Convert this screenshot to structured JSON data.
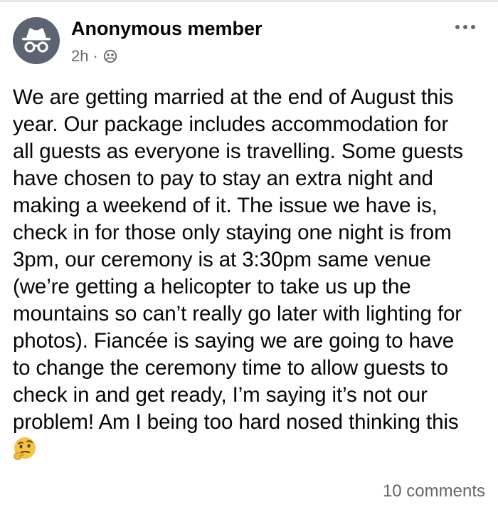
{
  "post": {
    "author": "Anonymous member",
    "time": "2h",
    "separator": "·",
    "privacy_icon": "group-privacy-icon",
    "more_icon": "more-options-icon",
    "body": "We are getting married at the end of August this\nyear.  Our package includes accommodation for\nall guests as everyone is travelling.  Some guests\nhave chosen to pay to stay an extra night and\nmaking a weekend of it.  The issue we have is,\ncheck in for those only staying one night is from\n3pm, our ceremony is at 3:30pm same venue\n(we’re getting a helicopter to take us up the\nmountains so can’t really go later with lighting for\nphotos).  Fiancée is saying we are going to have\nto change the ceremony time to allow guests to\ncheck in and get ready, I’m saying it’s not our\nproblem!  Am I being too hard nosed thinking this",
    "emoji": "thinking-face",
    "comments": "10 comments"
  },
  "colors": {
    "text": "#050505",
    "secondary": "#65676b",
    "avatar_bg": "#5b6470"
  }
}
